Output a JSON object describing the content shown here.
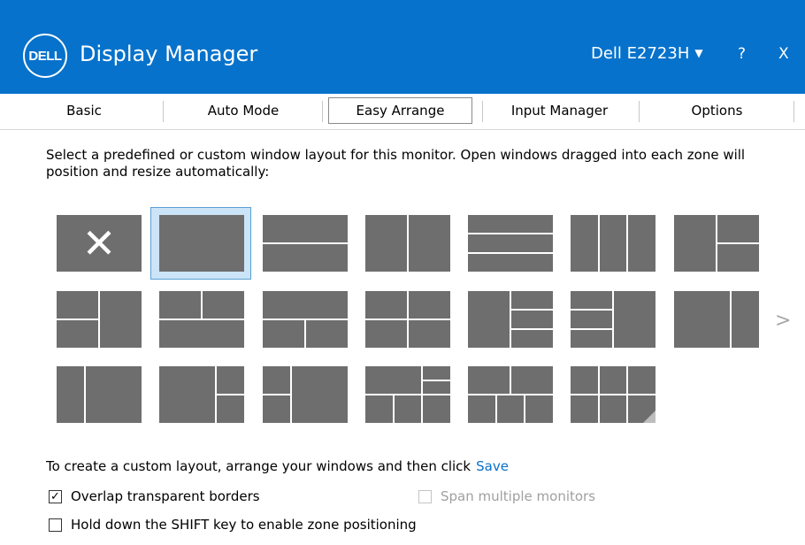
{
  "title_bar": {
    "logo_text": "DELL",
    "app_title": "Display Manager",
    "monitor_name": "Dell E2723H",
    "help_label": "?",
    "close_label": "X",
    "background_color": "#0672cb"
  },
  "tabs": [
    {
      "label": "Basic",
      "active": false
    },
    {
      "label": "Auto Mode",
      "active": false
    },
    {
      "label": "Easy Arrange",
      "active": true
    },
    {
      "label": "Input Manager",
      "active": false
    },
    {
      "label": "Options",
      "active": false
    }
  ],
  "description": "Select a predefined or custom window layout for this monitor.  Open windows dragged into each zone will position and resize automatically:",
  "layout_grid": {
    "selected_index": 1,
    "next_page_glyph": ">",
    "none_glyph": "✕"
  },
  "custom_layout": {
    "text": "To create a custom layout, arrange your windows and then click",
    "save_label": "Save"
  },
  "options": {
    "overlap_borders": {
      "label": "Overlap transparent borders",
      "checked": true,
      "enabled": true
    },
    "span_monitors": {
      "label": "Span multiple monitors",
      "checked": false,
      "enabled": false
    },
    "shift_key": {
      "label": "Hold down the SHIFT key to enable zone positioning",
      "checked": false,
      "enabled": true
    }
  }
}
